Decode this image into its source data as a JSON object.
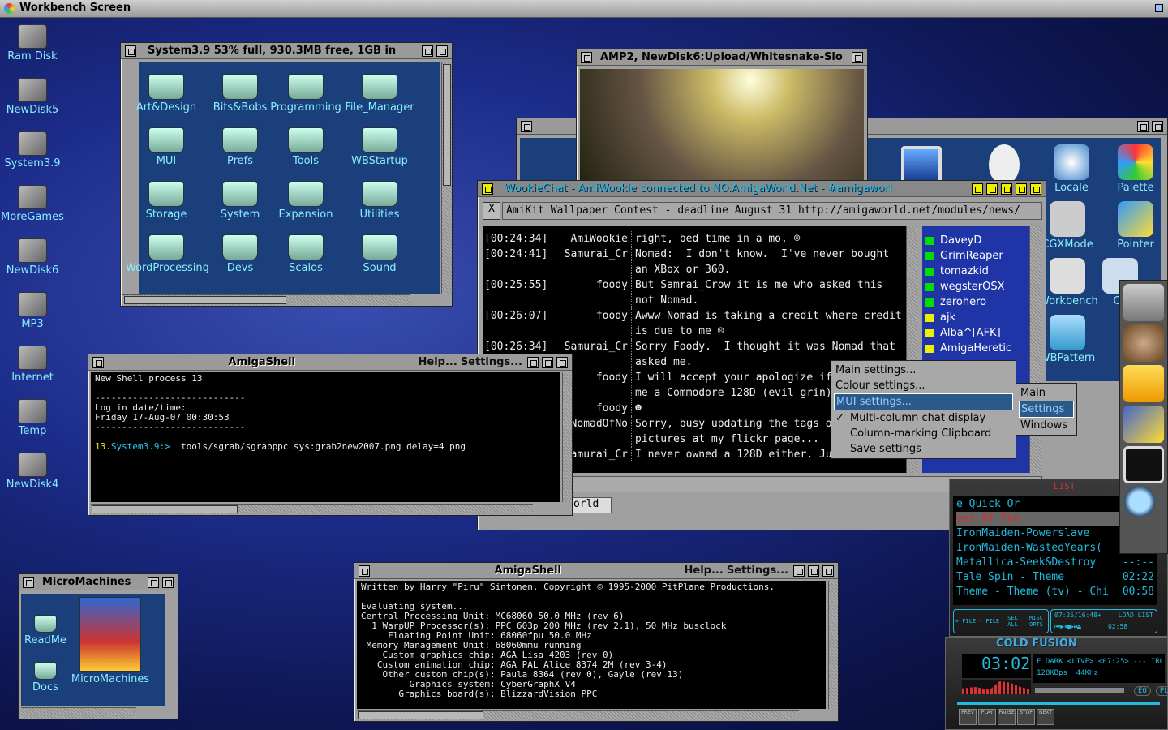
{
  "screen": {
    "title": "Workbench Screen"
  },
  "desktop_icons": [
    {
      "label": "Ram Disk"
    },
    {
      "label": "NewDisk5"
    },
    {
      "label": "System3.9"
    },
    {
      "label": "MoreGames"
    },
    {
      "label": "NewDisk6"
    },
    {
      "label": "MP3"
    },
    {
      "label": "Internet"
    },
    {
      "label": "Temp"
    },
    {
      "label": "NewDisk4"
    }
  ],
  "system_window": {
    "title": "System3.9   53% full, 930.3MB free, 1GB in",
    "icons": [
      {
        "label": "Art&Design"
      },
      {
        "label": "Bits&Bobs"
      },
      {
        "label": "Programming"
      },
      {
        "label": "File_Manager"
      },
      {
        "label": "MUI"
      },
      {
        "label": "Prefs"
      },
      {
        "label": "Tools"
      },
      {
        "label": "WBStartup"
      },
      {
        "label": "Storage"
      },
      {
        "label": "System"
      },
      {
        "label": "Expansion"
      },
      {
        "label": "Utilities"
      },
      {
        "label": "WordProcessing"
      },
      {
        "label": "Devs"
      },
      {
        "label": "Scalos"
      },
      {
        "label": "Sound"
      }
    ]
  },
  "video_window": {
    "title": "AMP2, NewDisk6:Upload/Whitesnake-Slo"
  },
  "prefs_window": {
    "icons": [
      {
        "label": "Locale"
      },
      {
        "label": "Palette"
      },
      {
        "label": "CGXMode"
      },
      {
        "label": "Pointer"
      },
      {
        "label": "Workbench"
      },
      {
        "label": "Ca"
      },
      {
        "label": "WBPattern"
      }
    ]
  },
  "chat_window": {
    "title": "WookieChat - AmiWookie connected to NO.AmigaWorld.Net - #amigaworl",
    "close_tab": "X",
    "topic": "AmiKit Wallpaper Contest - deadline August 31 http://amigaworld.net/modules/news/",
    "messages": [
      {
        "time": "[00:24:34]",
        "nick": "AmiWookie",
        "text": "right, bed time in a mo. ☺"
      },
      {
        "time": "[00:24:41]",
        "nick": "Samurai_Cr",
        "text": "Nomad:  I don't know.  I've never bought an XBox or 360."
      },
      {
        "time": "[00:25:55]",
        "nick": "foody",
        "text": "But Samrai_Crow it is me who asked this not Nomad."
      },
      {
        "time": "[00:26:07]",
        "nick": "foody",
        "text": "Awww Nomad is taking a credit where credit is due to me ☹"
      },
      {
        "time": "[00:26:34]",
        "nick": "Samurai_Cr",
        "text": "Sorry Foody.  I thought it was Nomad that asked me."
      },
      {
        "time": "",
        "nick": "foody",
        "text": "I will accept your apologize if you send me a Commodore 128D (evil grin)."
      },
      {
        "time": "",
        "nick": "foody",
        "text": "☻"
      },
      {
        "time": "",
        "nick": "NomadOfNo",
        "text": "Sorry, busy updating the tags on my pictures at my flickr page..."
      },
      {
        "time": "",
        "nick": "Samurai_Cr",
        "text": "I never owned a 128D either. Just the flat"
      }
    ],
    "users": [
      {
        "name": "DaveyD",
        "status": "op",
        "color": "#00dd00"
      },
      {
        "name": "GrimReaper",
        "color": "#00dd00"
      },
      {
        "name": "tomazkid",
        "color": "#00dd00"
      },
      {
        "name": "wegsterOSX",
        "color": "#00dd00"
      },
      {
        "name": "zerohero",
        "color": "#00dd00"
      },
      {
        "name": "ajk",
        "color": "#eeee00"
      },
      {
        "name": "Alba^[AFK]",
        "color": "#eeee00"
      },
      {
        "name": "AmigaHeretic",
        "color": "#eeee00"
      }
    ],
    "input_tab": "orld"
  },
  "context_menu": {
    "items": [
      {
        "label": "Main settings..."
      },
      {
        "label": "Colour settings..."
      },
      {
        "label": "MUI settings...",
        "selected": true
      },
      {
        "label": "Multi-column chat display",
        "checked": true
      },
      {
        "label": "Column-marking Clipboard"
      },
      {
        "label": "Save settings"
      }
    ],
    "submenu": [
      {
        "label": "Main"
      },
      {
        "label": "Settings",
        "selected": true
      },
      {
        "label": "Windows"
      }
    ]
  },
  "shell1": {
    "title": "AmigaShell",
    "menu_help": "Help...",
    "menu_settings": "Settings...",
    "lines": [
      "New Shell process 13",
      "",
      "----------------------------",
      "Log in date/time:",
      "Friday 17-Aug-07 00:30:53",
      "----------------------------",
      ""
    ],
    "prompt_num": "13.",
    "prompt_path": "System3.9:>",
    "command": "  tools/sgrab/sgrabppc sys:grab2new2007.png delay=4 png"
  },
  "shell2": {
    "title": "AmigaShell",
    "menu_help": "Help...",
    "menu_settings": "Settings...",
    "text": "Written by Harry \"Piru\" Sintonen. Copyright © 1995-2000 PitPlane Productions.\n\nEvaluating system...\nCentral Processing Unit: MC68060 50.0 MHz (rev 6)\n  1 WarpUP Processor(s): PPC 603p 200 MHz (rev 2.1), 50 MHz busclock\n     Floating Point Unit: 68060fpu 50.0 MHz\n Memory Management Unit: 68060mmu running\n    Custom graphics chip: AGA Lisa 4203 (rev 0)\n   Custom animation chip: AGA PAL Alice 8374 2M (rev 3-4)\n    Other custom chip(s): Paula 8364 (rev 0), Gayle (rev 13)\n         Graphics system: CyberGraphX V4\n       Graphics board(s): BlizzardVision PPC"
  },
  "micro_window": {
    "title": "MicroMachines",
    "icons": [
      {
        "label": "ReadMe"
      },
      {
        "label": "Docs"
      },
      {
        "label": "MicroMachines"
      }
    ]
  },
  "player": {
    "playlist_label": "LIST",
    "playlist": [
      {
        "title": "e Quick Or",
        "time": ""
      },
      {
        "title": "ear Of The",
        "time": "",
        "active": true
      },
      {
        "title": "IronMaiden-Powerslave",
        "time": ""
      },
      {
        "title": "IronMaiden-WastedYears(",
        "time": ""
      },
      {
        "title": "Metallica-Seek&Destroy",
        "time": "--:--"
      },
      {
        "title": "Tale Spin - Theme",
        "time": "02:22"
      },
      {
        "title": "Theme - Theme (tv) - Chi",
        "time": "00:58"
      }
    ],
    "pl_buttons": [
      "+ FILE",
      "- FILE",
      "SEL ALL",
      "MISC OPTS"
    ],
    "pl_info": "07:25/16:48+",
    "pl_time": "02:58",
    "load_list": "LOAD LIST",
    "brand": "COLD FUSION",
    "time": "03:02",
    "ticker": "E DARK  <LIVE>  <07:25>  ---  IRON",
    "bitrate": "128",
    "bitrate_unit": "KBps",
    "khz": "44",
    "khz_unit": "KHz",
    "eq": "EQ",
    "pl": "PL",
    "transport": [
      "PREV",
      "PLAY",
      "PAUSE",
      "STOP",
      "NEXT"
    ],
    "accent": "#22bbdd"
  }
}
